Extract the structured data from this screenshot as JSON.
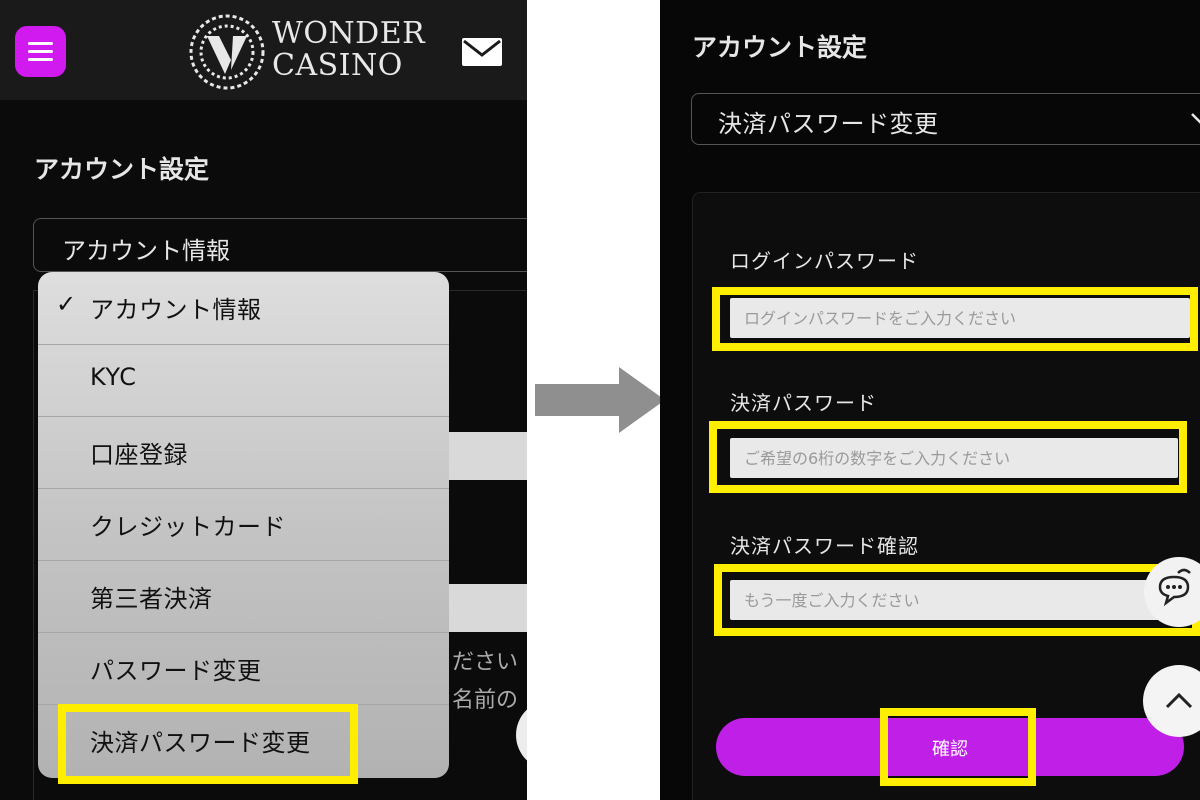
{
  "left": {
    "logo": {
      "line1": "WONDER",
      "line2": "CASINO"
    },
    "page_title": "アカウント設定",
    "select_value": "アカウント情報",
    "background_text": [
      "ださい",
      "名前の"
    ],
    "dropdown": {
      "selected_mark": "✓",
      "items": [
        {
          "label": "アカウント情報"
        },
        {
          "label": "KYC"
        },
        {
          "label": "口座登録"
        },
        {
          "label": "クレジットカード"
        },
        {
          "label": "第三者決済"
        },
        {
          "label": "パスワード変更"
        },
        {
          "label": "決済パスワード変更"
        }
      ]
    }
  },
  "right": {
    "page_title": "アカウント設定",
    "select_value": "決済パスワード変更",
    "fields": [
      {
        "label": "ログインパスワード",
        "placeholder": "ログインパスワードをご入力ください"
      },
      {
        "label": "決済パスワード",
        "placeholder": "ご希望の6桁の数字をご入力ください"
      },
      {
        "label": "決済パスワード確認",
        "placeholder": "もう一度ご入力ください"
      }
    ],
    "confirm_label": "確認"
  },
  "colors": {
    "accent": "#c01fe8",
    "menu_button": "#d11af0",
    "highlight": "#ffee00",
    "background": "#0b0b0b",
    "arrow": "#8f8f8f"
  },
  "icons": [
    "menu-icon",
    "logo-icon",
    "mail-icon",
    "chevron-down-icon",
    "chat-icon",
    "chevron-up-icon",
    "arrow-right-icon"
  ]
}
